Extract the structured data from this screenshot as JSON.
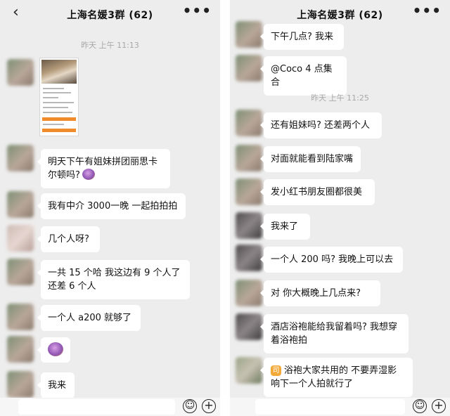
{
  "left": {
    "title": "上海名媛3群 (62)",
    "back_icon": "‹",
    "more_icon": "•••",
    "timestamp": "昨天 上午 11:13",
    "messages": [
      "明天下午有姐妹拼团丽思卡尔顿吗?",
      "我有中介 3000一晚 一起拍拍拍",
      "几个人呀?",
      "一共 15 个哈 我这边有 9 个人了还差 6 个人",
      "一个人 a200 就够了",
      "我来"
    ]
  },
  "right": {
    "title": "上海名媛3群 (62)",
    "more_icon": "•••",
    "timestamp": "昨天 上午 11:25",
    "messages": [
      "下午几点? 我来",
      "@Coco 4 点集合",
      "还有姐妹吗? 还差两个人",
      "对面就能看到陆家嘴",
      "发小红书朋友圈都很美",
      "我来了",
      "一个人 200 吗? 我晚上可以去",
      "对 你大概晚上几点来?",
      "酒店浴袍能给我留着吗? 我想穿着浴袍拍",
      "浴袍大家共用的 不要弄湿影响下一个人拍就行了"
    ],
    "quote_icon_char": "司"
  },
  "input_bar": {
    "emoji_glyph": "☺",
    "plus_glyph": "+"
  }
}
